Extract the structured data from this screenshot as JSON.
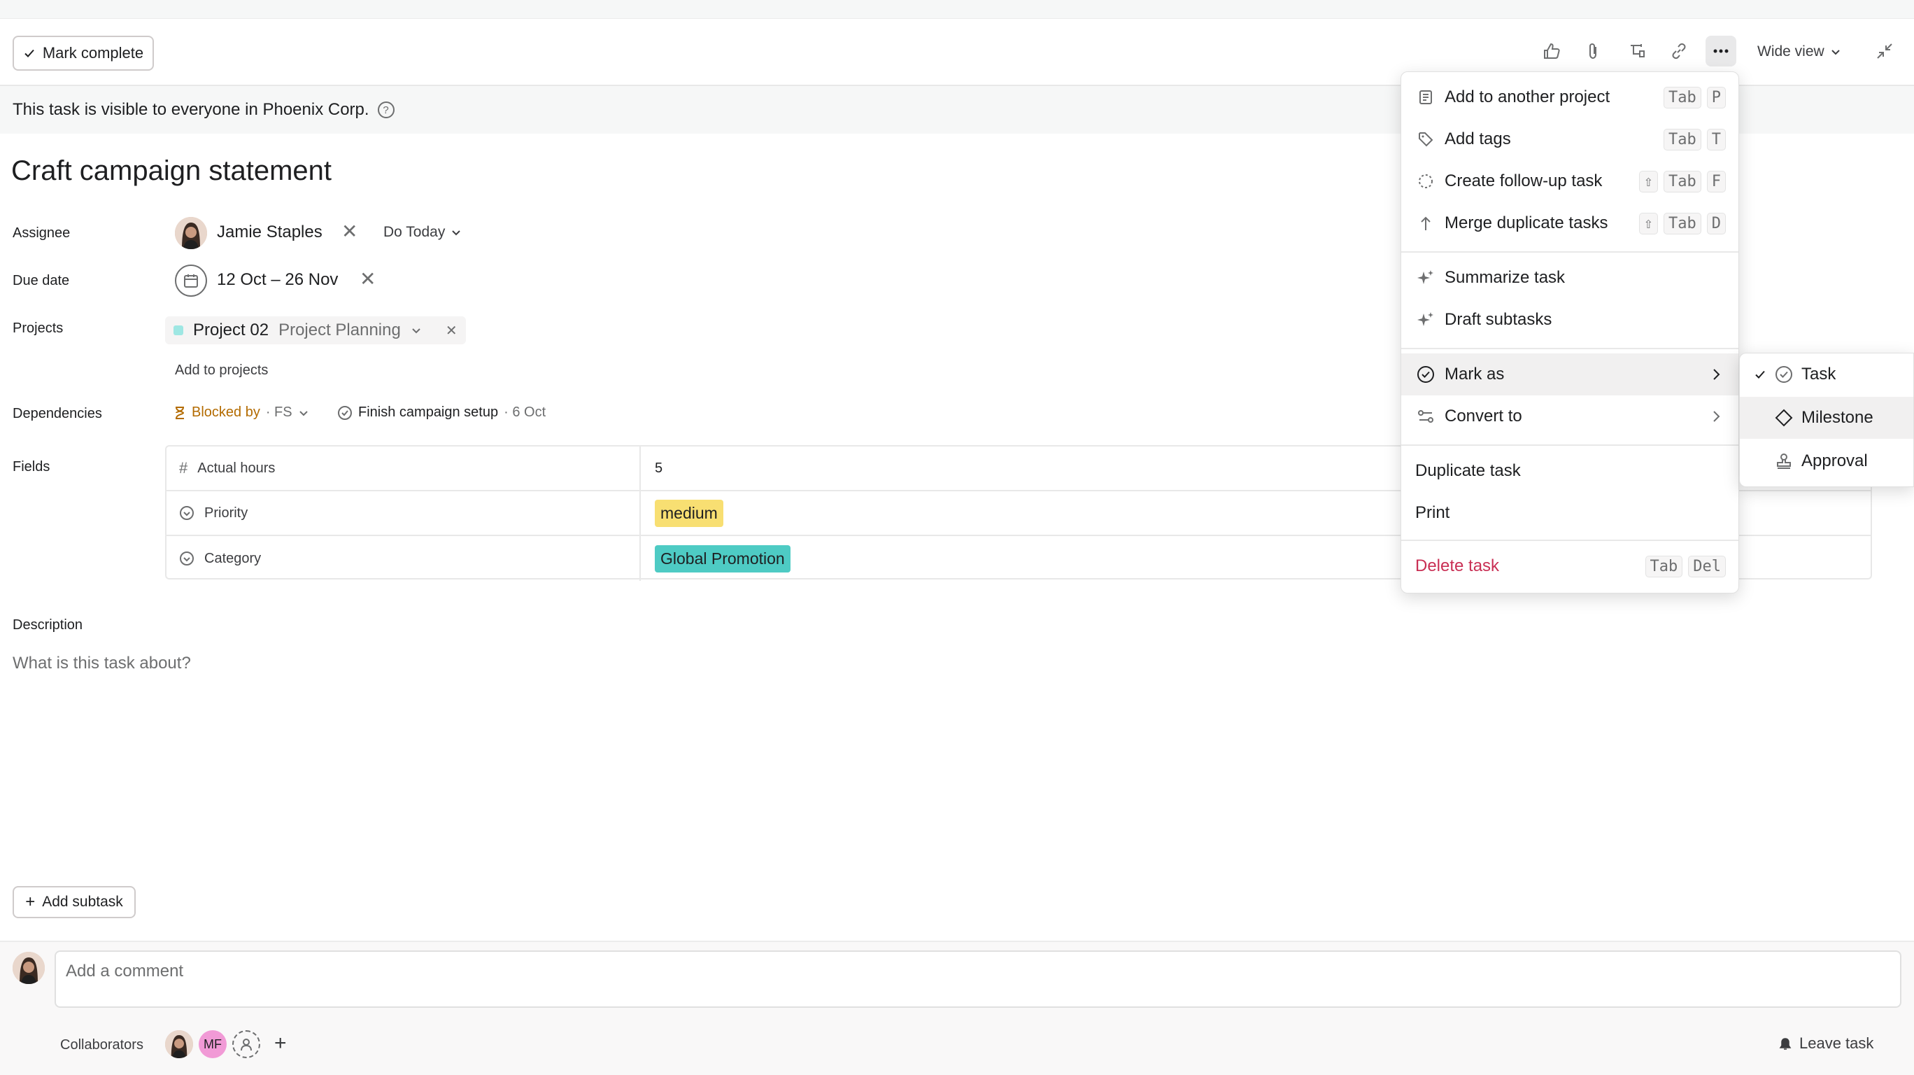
{
  "toolbar": {
    "mark_complete_label": "Mark complete",
    "wide_view_label": "Wide view"
  },
  "visibility_banner": "This task is visible to everyone in Phoenix Corp.",
  "task": {
    "title": "Craft campaign statement",
    "assignee_label": "Assignee",
    "assignee_name": "Jamie Staples",
    "assignee_when": "Do Today",
    "due_label": "Due date",
    "due_value": "12 Oct – 26 Nov",
    "projects_label": "Projects",
    "project_name": "Project 02",
    "project_section": "Project Planning",
    "add_to_projects": "Add to projects",
    "dependencies_label": "Dependencies",
    "blocked_by": "Blocked by",
    "dependency_type": "· FS",
    "dependency_task": "Finish campaign setup",
    "dependency_date": "· 6 Oct",
    "fields_label": "Fields",
    "fields": [
      {
        "name": "Actual hours",
        "value": "5"
      },
      {
        "name": "Priority",
        "value": "medium",
        "color": "#f8df72"
      },
      {
        "name": "Category",
        "value": "Global Promotion",
        "color": "#4ecbc4"
      }
    ],
    "description_label": "Description",
    "description_placeholder": "What is this task about?",
    "add_subtask": "Add subtask"
  },
  "comment": {
    "placeholder": "Add a comment",
    "collaborators_label": "Collaborators",
    "collaborator_initials": "MF",
    "leave_task": "Leave task"
  },
  "menu": {
    "items": [
      {
        "label": "Add to another project",
        "keys": [
          "Tab",
          "P"
        ]
      },
      {
        "label": "Add tags",
        "keys": [
          "Tab",
          "T"
        ]
      },
      {
        "label": "Create follow-up task",
        "keys": [
          "⇧",
          "Tab",
          "F"
        ]
      },
      {
        "label": "Merge duplicate tasks",
        "keys": [
          "⇧",
          "Tab",
          "D"
        ]
      },
      {
        "label": "Summarize task"
      },
      {
        "label": "Draft subtasks"
      },
      {
        "label": "Mark as"
      },
      {
        "label": "Convert to"
      },
      {
        "label": "Duplicate task"
      },
      {
        "label": "Print"
      },
      {
        "label": "Delete task",
        "keys": [
          "Tab",
          "Del"
        ],
        "color": "#c92f54"
      }
    ]
  },
  "submenu": {
    "items": [
      {
        "label": "Task",
        "checked": true
      },
      {
        "label": "Milestone"
      },
      {
        "label": "Approval"
      }
    ]
  }
}
